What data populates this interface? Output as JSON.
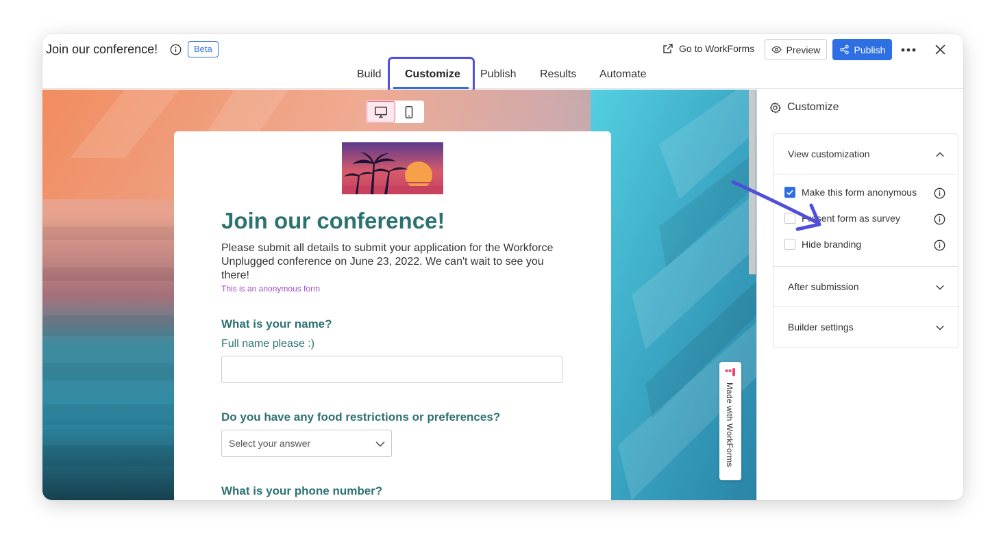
{
  "header": {
    "title": "Join our conference!",
    "badge": "Beta",
    "go_to": "Go to WorkForms",
    "preview": "Preview",
    "publish": "Publish"
  },
  "tabs": [
    {
      "label": "Build"
    },
    {
      "label": "Customize",
      "active": true
    },
    {
      "label": "Publish"
    },
    {
      "label": "Results"
    },
    {
      "label": "Automate"
    }
  ],
  "form": {
    "heading": "Join our conference!",
    "description": "Please submit all details to submit your application for the Workforce Unplugged conference on June 23, 2022. We can't wait to see you there!",
    "anonymous_note": "This is an anonymous form",
    "questions": [
      {
        "label": "What is your name?",
        "sublabel": "Full name please :)"
      },
      {
        "label": "Do you have any food restrictions or preferences?",
        "placeholder": "Select your answer"
      },
      {
        "label": "What is your phone number?"
      }
    ],
    "made_with": "Made with WorkForms"
  },
  "panel": {
    "title": "Customize",
    "sections": [
      {
        "label": "View customization",
        "expanded": true
      },
      {
        "label": "After submission",
        "expanded": false
      },
      {
        "label": "Builder settings",
        "expanded": false
      }
    ],
    "options": [
      {
        "label": "Make this form anonymous",
        "checked": true
      },
      {
        "label": "Present form as survey",
        "checked": false
      },
      {
        "label": "Hide branding",
        "checked": false
      }
    ]
  },
  "colors": {
    "accent": "#2f6fe4",
    "form_heading": "#2c7271",
    "anonymous_note": "#a34ec9",
    "highlight": "#5050e0"
  }
}
